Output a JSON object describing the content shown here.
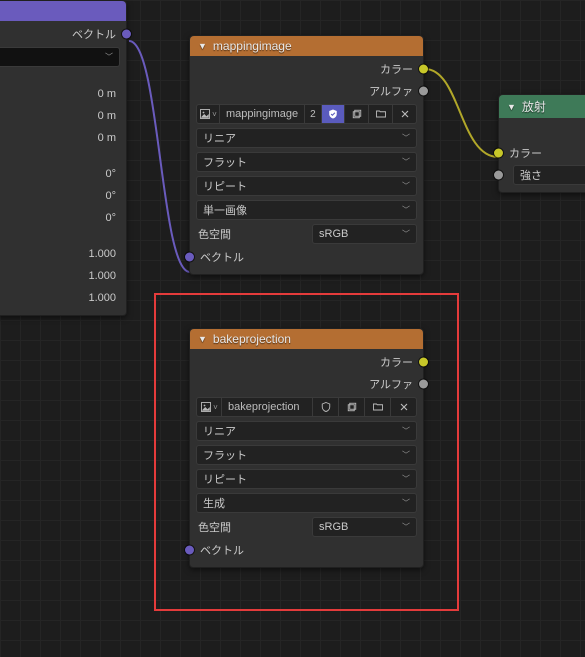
{
  "mappingimage_node": {
    "title": "mappingimage",
    "out_color": "カラー",
    "out_alpha": "アルファ",
    "image_name": "mappingimage",
    "user_count": "2",
    "interp": "リニア",
    "projection": "フラット",
    "extension": "リピート",
    "source": "単一画像",
    "colorspace_label": "色空間",
    "colorspace_value": "sRGB",
    "in_vector": "ベクトル"
  },
  "bakeprojection_node": {
    "title": "bakeprojection",
    "out_color": "カラー",
    "out_alpha": "アルファ",
    "image_name": "bakeprojection",
    "interp": "リニア",
    "projection": "フラット",
    "extension": "リピート",
    "source": "生成",
    "colorspace_label": "色空間",
    "colorspace_value": "sRGB",
    "in_vector": "ベクトル"
  },
  "emission_node": {
    "title": "放射",
    "in_color": "カラー",
    "in_strength": "強さ"
  },
  "partial_mapping": {
    "out_vector": "ベクトル",
    "loc_x": "0 m",
    "loc_y": "0 m",
    "loc_z": "0 m",
    "rot_x": "0°",
    "rot_y": "0°",
    "rot_z": "0°",
    "scale_x": "1.000",
    "scale_y": "1.000",
    "scale_z": "1.000"
  }
}
